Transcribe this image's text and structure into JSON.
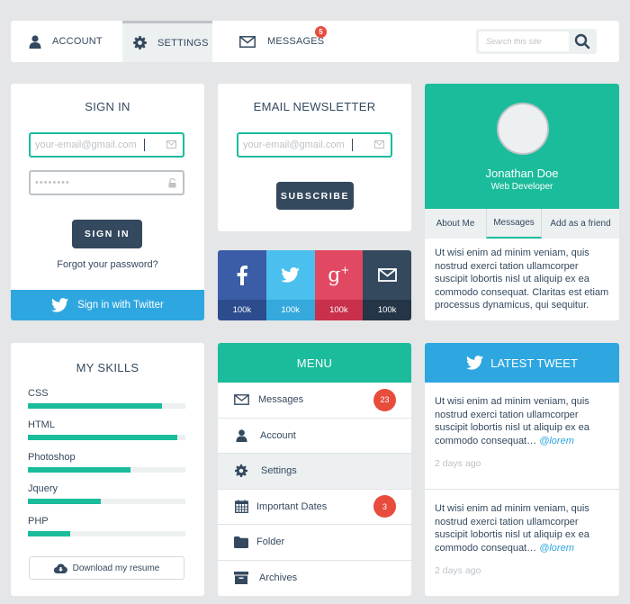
{
  "nav": {
    "items": [
      {
        "label": "ACCOUNT",
        "icon": "user-icon"
      },
      {
        "label": "SETTINGS",
        "icon": "gear-icon",
        "active": true
      },
      {
        "label": "MESSAGES",
        "icon": "envelope-icon",
        "badge": "5"
      }
    ],
    "search": {
      "placeholder": "Search this site",
      "value": ""
    }
  },
  "signin": {
    "title": "SIGN IN",
    "email_placeholder": "your-email@gmail.com",
    "password_value": "••••••••",
    "button": "SIGN IN",
    "forgot": "Forgot your password?",
    "twitter": "Sign in with Twitter"
  },
  "newsletter": {
    "title": "EMAIL NEWSLETTER",
    "email_placeholder": "your-email@gmail.com",
    "button": "SUBSCRIBE"
  },
  "social": [
    {
      "network": "facebook",
      "count": "100k",
      "color": "#3b5da7",
      "dark": "#2d4c8e"
    },
    {
      "network": "twitter",
      "count": "100k",
      "color": "#4bbfee",
      "dark": "#35a9dc"
    },
    {
      "network": "google-plus",
      "count": "100k",
      "color": "#e14862",
      "dark": "#c9304c"
    },
    {
      "network": "email",
      "count": "100k",
      "color": "#34495e",
      "dark": "#243547"
    }
  ],
  "profile": {
    "name": "Jonathan Doe",
    "role": "Web Developer",
    "tabs": [
      "About Me",
      "Messages",
      "Add as a friend"
    ],
    "active_tab": 1,
    "text": "Ut wisi enim ad minim veniam, quis nostrud exerci tation ullamcorper suscipit lobortis nisl ut aliquip ex ea commodo consequat. Claritas est etiam processus dynamicus, qui sequitur."
  },
  "skills": {
    "title": "MY SKILLS",
    "items": [
      {
        "name": "CSS",
        "percent": 85
      },
      {
        "name": "HTML",
        "percent": 95
      },
      {
        "name": "Photoshop",
        "percent": 65
      },
      {
        "name": "Jquery",
        "percent": 46
      },
      {
        "name": "PHP",
        "percent": 27
      }
    ],
    "download": "Download my resume"
  },
  "menu": {
    "title": "MENU",
    "items": [
      {
        "label": "Messages",
        "icon": "envelope-icon",
        "badge": "23"
      },
      {
        "label": "Account",
        "icon": "user-icon"
      },
      {
        "label": "Settings",
        "icon": "gear-icon",
        "active": true
      },
      {
        "label": "Important Dates",
        "icon": "calendar-icon",
        "badge": "3"
      },
      {
        "label": "Folder",
        "icon": "folder-icon"
      },
      {
        "label": "Archives",
        "icon": "archive-icon"
      }
    ]
  },
  "tweets": {
    "title": "LATEST TWEET",
    "items": [
      {
        "text": "Ut wisi enim ad minim veniam, quis nostrud exerci tation ullamcorper suscipit lobortis nisl ut aliquip ex ea commodo consequat…",
        "handle": "@lorem",
        "time": "2 days ago"
      },
      {
        "text": "Ut wisi enim ad minim veniam, quis nostrud exerci tation ullamcorper suscipit lobortis nisl ut aliquip ex ea commodo consequat…",
        "handle": "@lorem",
        "time": "2 days ago"
      }
    ]
  },
  "colors": {
    "accent": "#1abc9c",
    "dark": "#34495e",
    "twitter": "#2ea7e0",
    "badge": "#e74c3c",
    "light": "#ecf0f1"
  }
}
